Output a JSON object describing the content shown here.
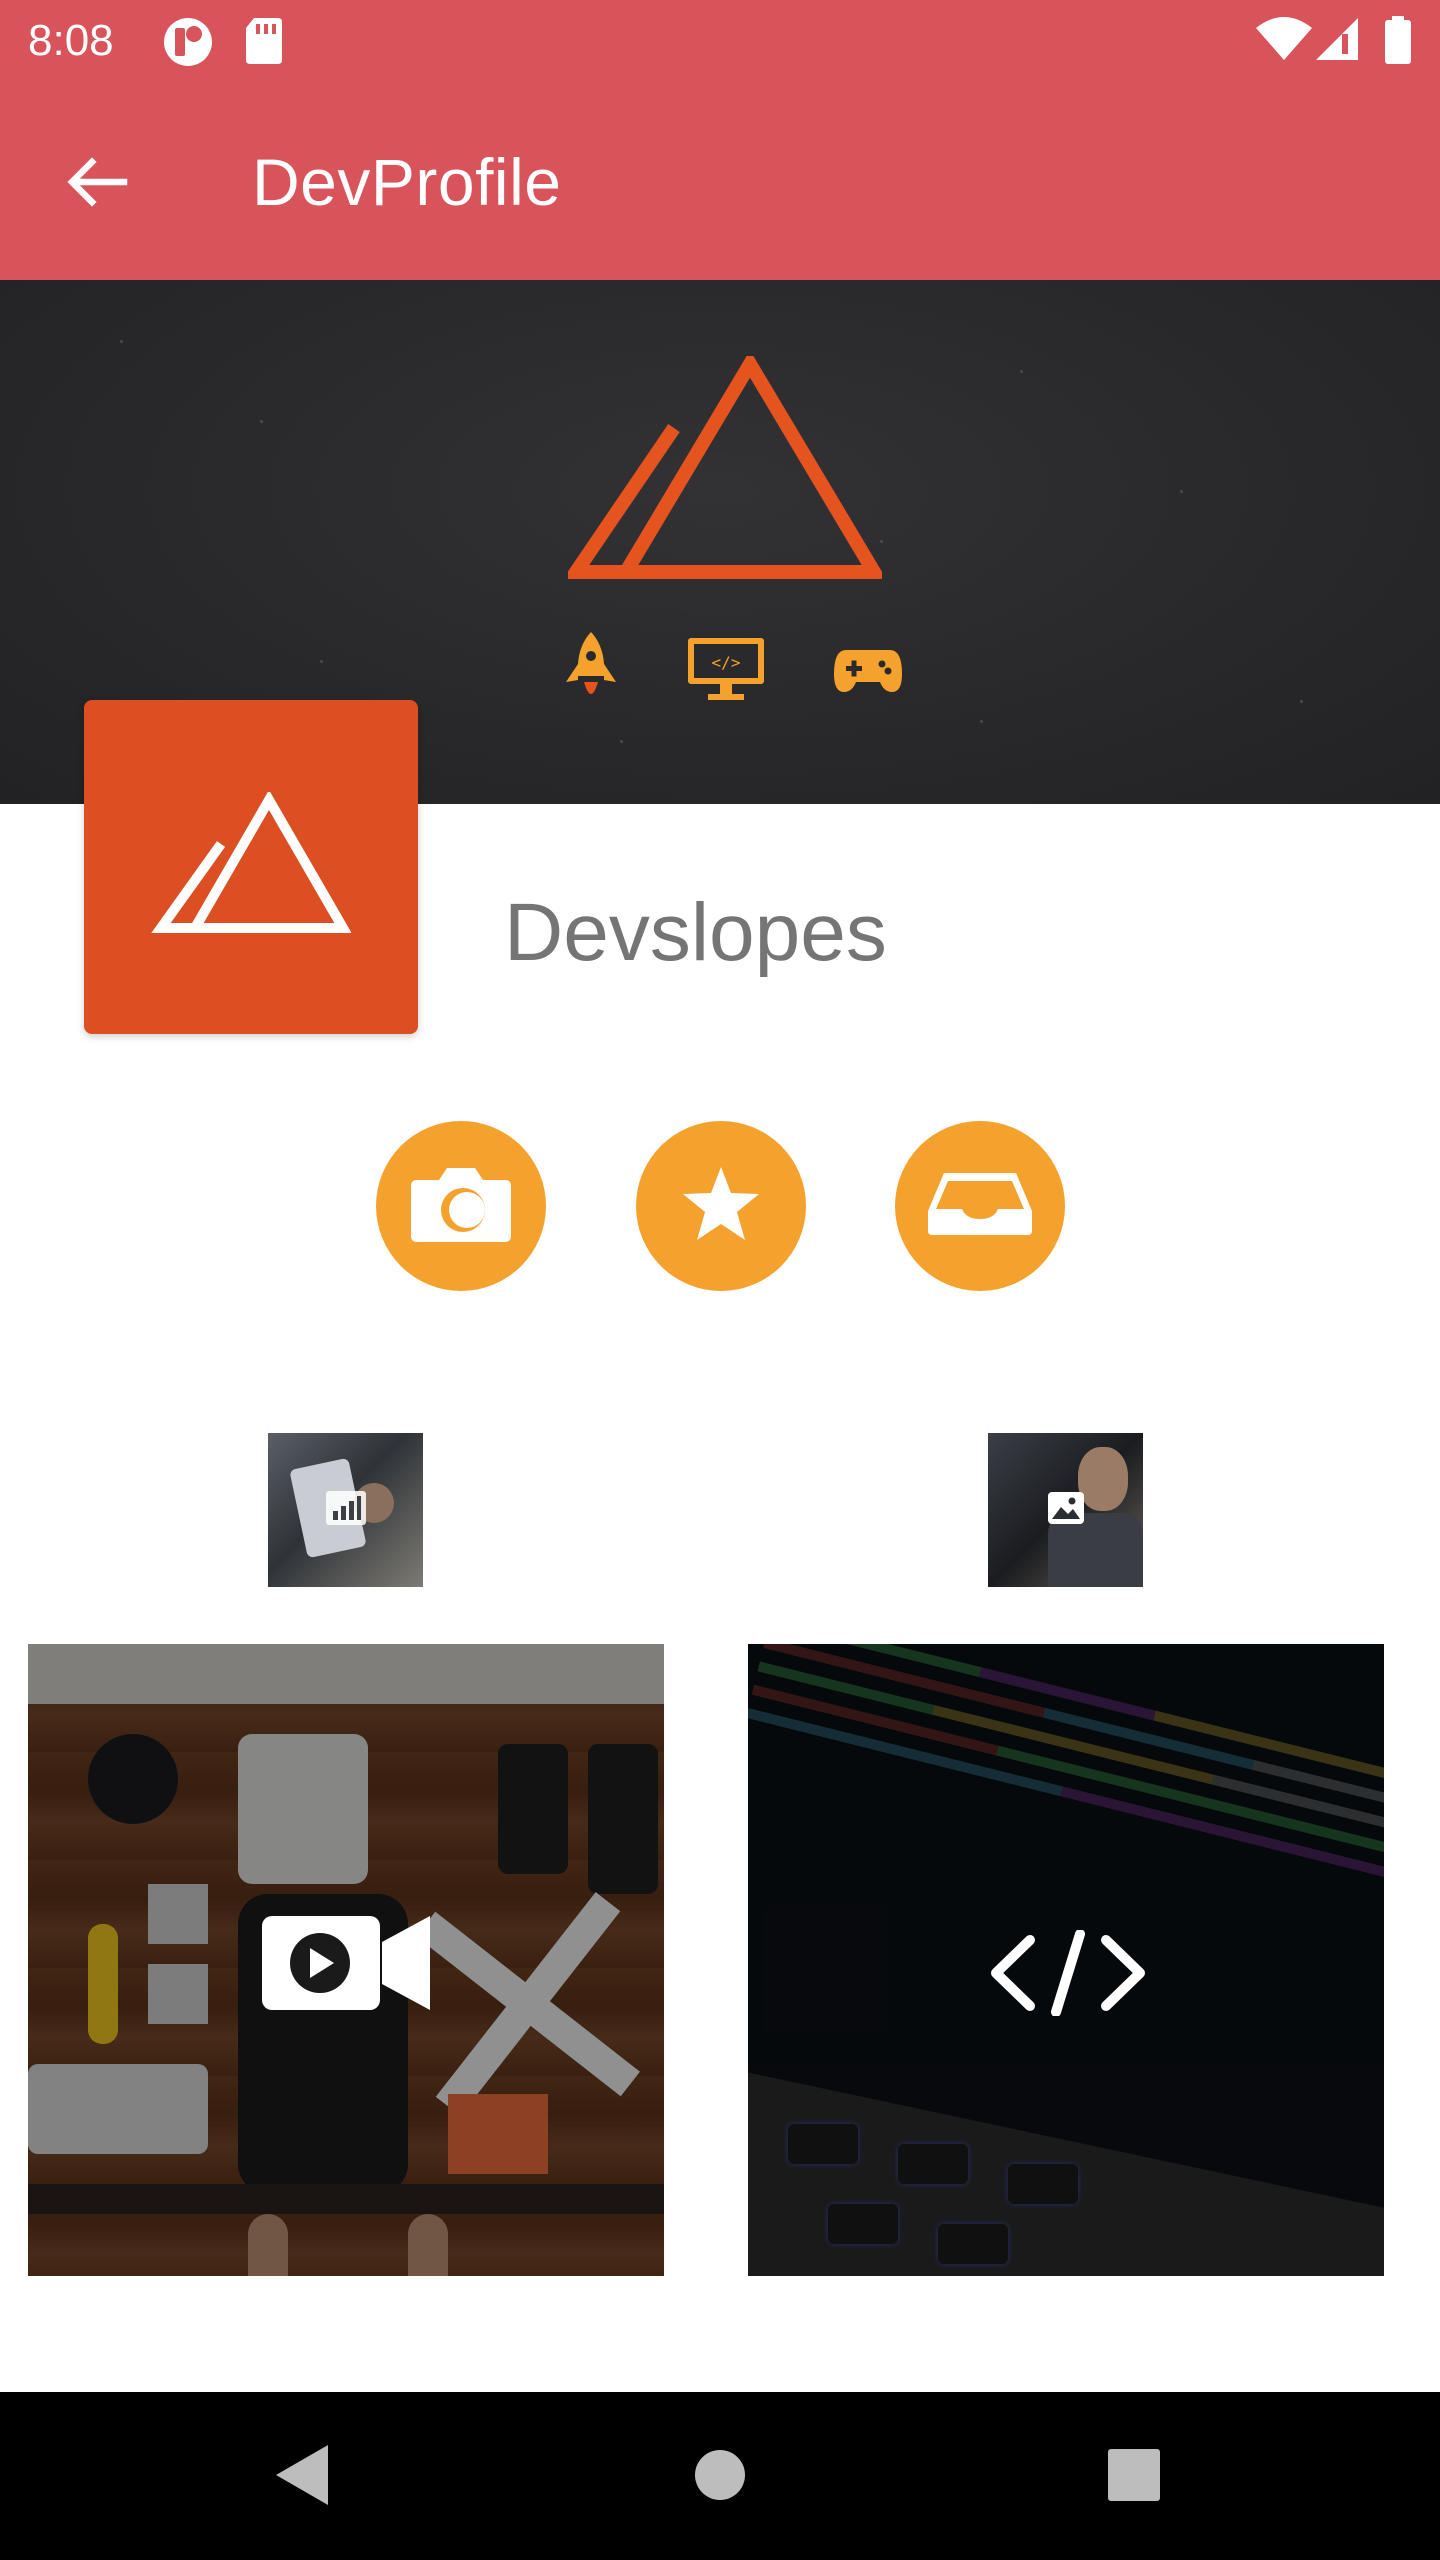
{
  "status_bar": {
    "time": "8:08",
    "icons": [
      "notification-icon",
      "sd-card-icon",
      "wifi-icon",
      "signal-icon",
      "battery-icon"
    ]
  },
  "app_bar": {
    "title": "DevProfile",
    "back_icon": "arrow-back-icon",
    "background": "#d9535a"
  },
  "banner": {
    "icons": [
      "mountain-logo-icon",
      "rocket-icon",
      "code-monitor-icon",
      "gamepad-icon"
    ]
  },
  "profile": {
    "name": "Devslopes",
    "logo_icon": "mountain-logo-icon",
    "logo_color": "#dd4e22"
  },
  "actions": [
    {
      "icon": "camera-icon"
    },
    {
      "icon": "star-icon"
    },
    {
      "icon": "inbox-icon"
    }
  ],
  "accent_color": "#f4a22d",
  "thumbnails": [
    {
      "icon": "chart-icon"
    },
    {
      "icon": "image-icon"
    }
  ],
  "tiles": [
    {
      "icon": "video-camera-icon"
    },
    {
      "icon": "code-icon"
    }
  ],
  "nav_bar": {
    "icons": [
      "back-triangle-icon",
      "home-circle-icon",
      "recents-square-icon"
    ]
  }
}
